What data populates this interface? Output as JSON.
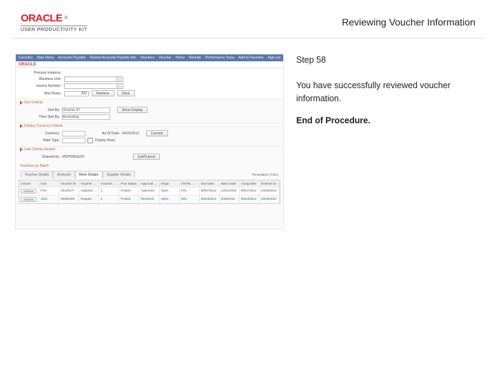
{
  "header": {
    "logo_main": "ORACLE",
    "logo_tm": "®",
    "logo_sub": "USER PRODUCTIVITY KIT",
    "page_title": "Reviewing Voucher Information"
  },
  "side": {
    "step": "Step 58",
    "msg": "You have successfully reviewed voucher information.",
    "end": "End of Procedure."
  },
  "shot": {
    "nav_left": [
      "Favorites",
      "Main Menu",
      "Accounts Payable",
      "Review Accounts Payable Info",
      "Vouchers",
      "Voucher"
    ],
    "nav_right": [
      "Home",
      "Worklist",
      "Performance Trace",
      "Add to Favorites",
      "Sign out"
    ],
    "bar_logo": "ORACLE",
    "form": {
      "l1": "Process Instance:",
      "l2": "Business Unit:",
      "l3": "Invoice Number:",
      "l4": "Max Rows:",
      "v4": "300",
      "retrieve": "Retrieve",
      "clear": "Clear"
    },
    "sec1": {
      "title": "Sort Criteria",
      "l1": "Sort By:",
      "v1": "Voucher ID",
      "btn": "Show Display",
      "l2": "Then Sort By:",
      "v2": "Ascending"
    },
    "sec2": {
      "title": "Display Currency Criteria",
      "l1": "Currency:",
      "v1": "",
      "l2": "As Of Date:",
      "v2": "04/25/2012",
      "l3": "Rate Type:",
      "v3": "",
      "convert": "Convert",
      "chk": "Display Base"
    },
    "sec3": {
      "title": "Last Criteria Version",
      "l1": "Entered by:",
      "v1": "MSPRINGER1",
      "btn": "Exit/Cancel"
    },
    "vouch": {
      "title": "Vouchers by Batch",
      "tabs": [
        "Voucher Details",
        "Amounts",
        "More Details",
        "Supplier Details"
      ],
      "find": "Personalize | Find |",
      "cols": [
        "Actions",
        "Unit",
        "Voucher ID",
        "Voucher Style",
        "Voucher Lines",
        "Post Status",
        "Approval Status",
        "Origin",
        "CNTRL GRP",
        "Due Date",
        "Basic Date",
        "Acctg Date",
        "Entered on"
      ],
      "rows": [
        [
          "Actions",
          "FSC",
          "00139177",
          "Adjusted Voucher",
          "1",
          "Posted",
          "Approved",
          "Open",
          "FSC",
          "06/07/2012",
          "10/01/2040",
          "06/07/2012",
          "04/25/2012"
        ],
        [
          "Actions",
          "JDIC",
          "00000169",
          "Regular Voucher",
          "1",
          "Posted",
          "Received",
          "Open",
          "ONL",
          "06/23/2012",
          "3/25/2016",
          "06/23/2012",
          "03/28/2012"
        ]
      ]
    }
  }
}
